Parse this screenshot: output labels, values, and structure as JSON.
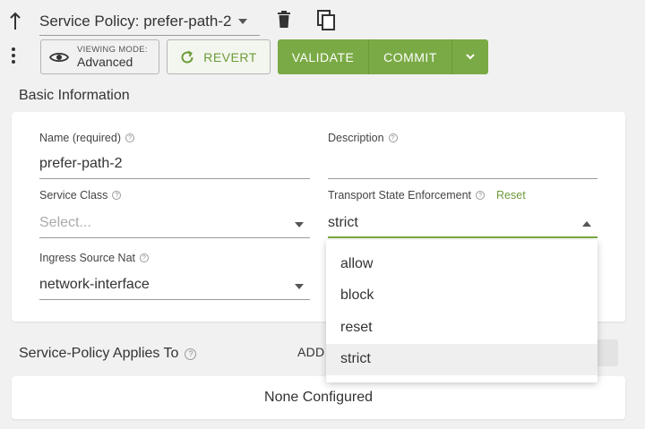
{
  "toolbar": {
    "policy_title": "Service Policy: prefer-path-2",
    "viewing_mode_label": "VIEWING MODE:",
    "viewing_mode_value": "Advanced",
    "revert_label": "REVERT",
    "validate_label": "VALIDATE",
    "commit_label": "COMMIT"
  },
  "basic_info": {
    "title": "Basic Information",
    "name_label": "Name (required)",
    "name_value": "prefer-path-2",
    "description_label": "Description",
    "description_value": "",
    "service_class_label": "Service Class",
    "service_class_placeholder": "Select...",
    "transport_label": "Transport State Enforcement",
    "transport_reset": "Reset",
    "transport_value": "strict",
    "ingress_label": "Ingress Source Nat",
    "ingress_value": "network-interface"
  },
  "transport_dropdown": {
    "options": [
      "allow",
      "block",
      "reset",
      "strict"
    ],
    "selected": "strict"
  },
  "applies_to": {
    "title": "Service-Policy Applies To",
    "add_label": "ADD",
    "empty_text": "None Configured"
  },
  "colors": {
    "accent_green": "#7aaa45",
    "background": "#f1f1f1"
  }
}
